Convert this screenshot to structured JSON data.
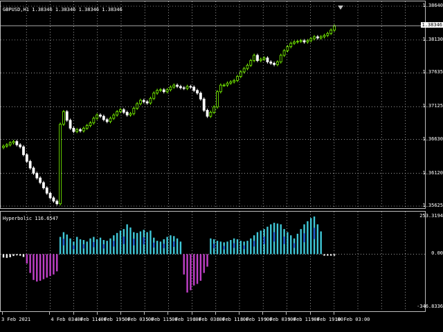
{
  "chart_header": {
    "symbol_info": "GBPUSD,H1",
    "ohlc": "1.38346 1.38346 1.38346 1.38346"
  },
  "price_axis": {
    "labels": [
      "1.38640",
      "1.38130",
      "1.37635",
      "1.37125",
      "1.36630",
      "1.36120",
      "1.35625"
    ],
    "current_price": "1.38346"
  },
  "indicator": {
    "label": "Hyperbolic 116.6547",
    "axis_labels": [
      "253.3194",
      "0.00",
      "-346.8336"
    ]
  },
  "time_axis": {
    "labels": [
      "3 Feb 2021",
      "4 Feb 03:00",
      "4 Feb 11:00",
      "4 Feb 19:00",
      "5 Feb 03:00",
      "5 Feb 11:00",
      "5 Feb 19:00",
      "8 Feb 03:00",
      "8 Feb 11:00",
      "8 Feb 19:00",
      "9 Feb 03:00",
      "9 Feb 11:00",
      "9 Feb 19:00",
      "10 Feb 03:00"
    ]
  },
  "colors": {
    "background": "#000000",
    "grid": "#ffffff",
    "bull_candle": "#7cfc00",
    "bear_candle": "#ffffff",
    "hist_positive": "#40c8d8",
    "hist_positive_dark": "#2060d0",
    "hist_negative": "#c040c8",
    "hist_negative_light": "#f0f0f0"
  },
  "chart_data": {
    "type": "candlestick",
    "ylim": [
      1.35625,
      1.3864
    ],
    "closes": [
      1.3653,
      1.3655,
      1.3658,
      1.366,
      1.3655,
      1.3652,
      1.364,
      1.363,
      1.362,
      1.3612,
      1.3605,
      1.3598,
      1.359,
      1.3582,
      1.3575,
      1.357,
      1.3566,
      1.3686,
      1.3705,
      1.3692,
      1.368,
      1.3675,
      1.3678,
      1.3676,
      1.368,
      1.3684,
      1.3688,
      1.3695,
      1.37,
      1.3698,
      1.3693,
      1.369,
      1.3695,
      1.37,
      1.3705,
      1.3708,
      1.3704,
      1.37,
      1.3702,
      1.371,
      1.3717,
      1.3722,
      1.372,
      1.3718,
      1.3725,
      1.3733,
      1.3737,
      1.3738,
      1.3735,
      1.3738,
      1.3742,
      1.3745,
      1.3743,
      1.3741,
      1.374,
      1.3743,
      1.3742,
      1.3737,
      1.3733,
      1.3724,
      1.3707,
      1.3698,
      1.3704,
      1.3712,
      1.3735,
      1.3745,
      1.3745,
      1.3748,
      1.375,
      1.3752,
      1.3758,
      1.3765,
      1.377,
      1.3775,
      1.3782,
      1.379,
      1.3782,
      1.3784,
      1.3786,
      1.378,
      1.3778,
      1.3776,
      1.378,
      1.379,
      1.3797,
      1.3803,
      1.3808,
      1.381,
      1.3811,
      1.3812,
      1.381,
      1.3812,
      1.3815,
      1.3818,
      1.3816,
      1.3818,
      1.382,
      1.3823,
      1.3828,
      1.3834
    ],
    "indicator_values": [
      -22,
      -24,
      -20,
      -12,
      -8,
      -10,
      -18,
      -60,
      -120,
      -165,
      -175,
      -170,
      -160,
      -150,
      -140,
      -130,
      -110,
      110,
      140,
      125,
      100,
      80,
      110,
      95,
      90,
      80,
      100,
      110,
      95,
      105,
      90,
      85,
      100,
      120,
      135,
      150,
      160,
      190,
      170,
      140,
      135,
      145,
      155,
      140,
      150,
      105,
      85,
      80,
      95,
      110,
      120,
      115,
      100,
      80,
      -130,
      -245,
      -230,
      -200,
      -190,
      -170,
      -120,
      -80,
      100,
      95,
      85,
      80,
      75,
      80,
      90,
      100,
      95,
      85,
      80,
      85,
      100,
      120,
      140,
      150,
      160,
      175,
      190,
      200,
      195,
      190,
      160,
      140,
      120,
      100,
      130,
      160,
      190,
      210,
      230,
      240,
      190,
      145,
      -10,
      -10,
      -10,
      -10
    ],
    "indicator_ylim": [
      -346.8336,
      253.3194
    ]
  }
}
